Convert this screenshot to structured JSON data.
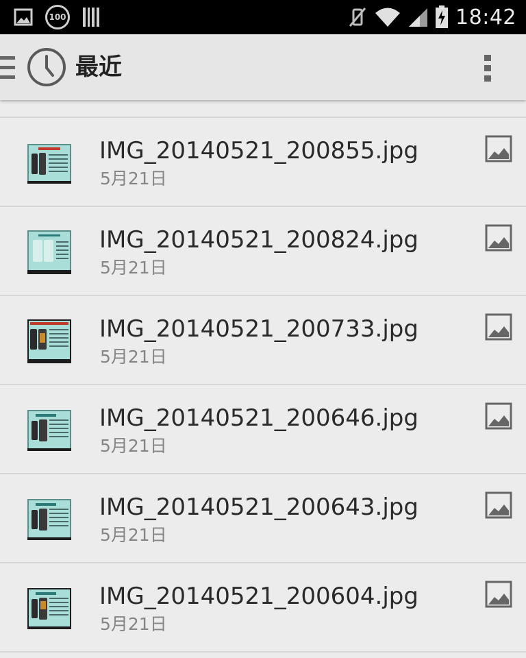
{
  "status_bar": {
    "battery_badge": "100",
    "time": "18:42"
  },
  "action_bar": {
    "title": "最近"
  },
  "files": [
    {
      "name": "IMG_20140521_200855.jpg",
      "date": "5月21日",
      "type": "image-icon"
    },
    {
      "name": "IMG_20140521_200824.jpg",
      "date": "5月21日",
      "type": "image-icon"
    },
    {
      "name": "IMG_20140521_200733.jpg",
      "date": "5月21日",
      "type": "image-icon"
    },
    {
      "name": "IMG_20140521_200646.jpg",
      "date": "5月21日",
      "type": "image-icon"
    },
    {
      "name": "IMG_20140521_200643.jpg",
      "date": "5月21日",
      "type": "image-icon"
    },
    {
      "name": "IMG_20140521_200604.jpg",
      "date": "5月21日",
      "type": "image-icon"
    }
  ],
  "colors": {
    "background": "#ececec",
    "action_bar": "#e6e6e6",
    "status_bar": "#000000",
    "divider": "#d6d6d6"
  }
}
